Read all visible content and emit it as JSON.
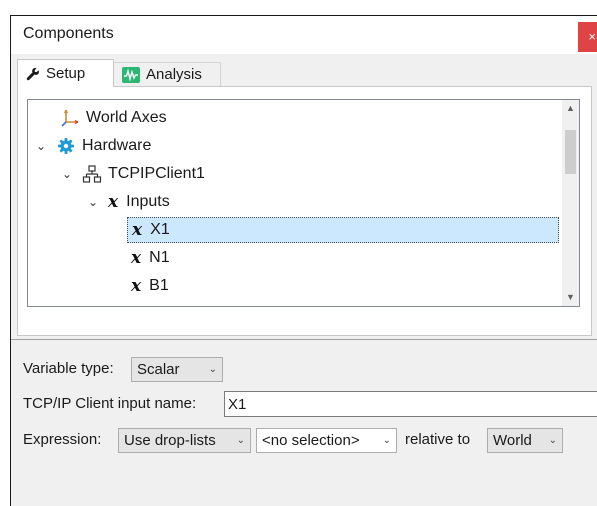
{
  "window": {
    "title": "Components",
    "close_glyph": "×"
  },
  "tabs": [
    {
      "label": "Setup",
      "icon": "wrench-icon",
      "active": true
    },
    {
      "label": "Analysis",
      "icon": "analysis-icon",
      "active": false
    }
  ],
  "tree": {
    "items": [
      {
        "label": "World Axes",
        "icon": "axes-icon",
        "level": 1,
        "expanded": null
      },
      {
        "label": "Hardware",
        "icon": "gear-icon",
        "level": 0,
        "expanded": true
      },
      {
        "label": "TCPIPClient1",
        "icon": "network-icon",
        "level": 1,
        "expanded": true
      },
      {
        "label": "Inputs",
        "icon": "variable-x-icon",
        "level": 2,
        "expanded": true
      },
      {
        "label": "X1",
        "icon": "variable-x-icon",
        "level": 3,
        "selected": true
      },
      {
        "label": "N1",
        "icon": "variable-x-icon",
        "level": 3
      },
      {
        "label": "B1",
        "icon": "variable-x-icon",
        "level": 3
      }
    ],
    "x_glyph": "x"
  },
  "properties": {
    "variable_type_label": "Variable type:",
    "variable_type_value": "Scalar",
    "input_name_label": "TCP/IP Client input name:",
    "input_name_value": "X1",
    "expression_label": "Expression:",
    "expression_mode": "Use drop-lists",
    "expression_selection": "<no selection>",
    "relative_to_label": "relative to",
    "relative_to_value": "World"
  },
  "colors": {
    "selection": "#cce8ff",
    "close_button": "#e04343",
    "gear": "#1e9bd7",
    "analysis": "#2bb673"
  }
}
